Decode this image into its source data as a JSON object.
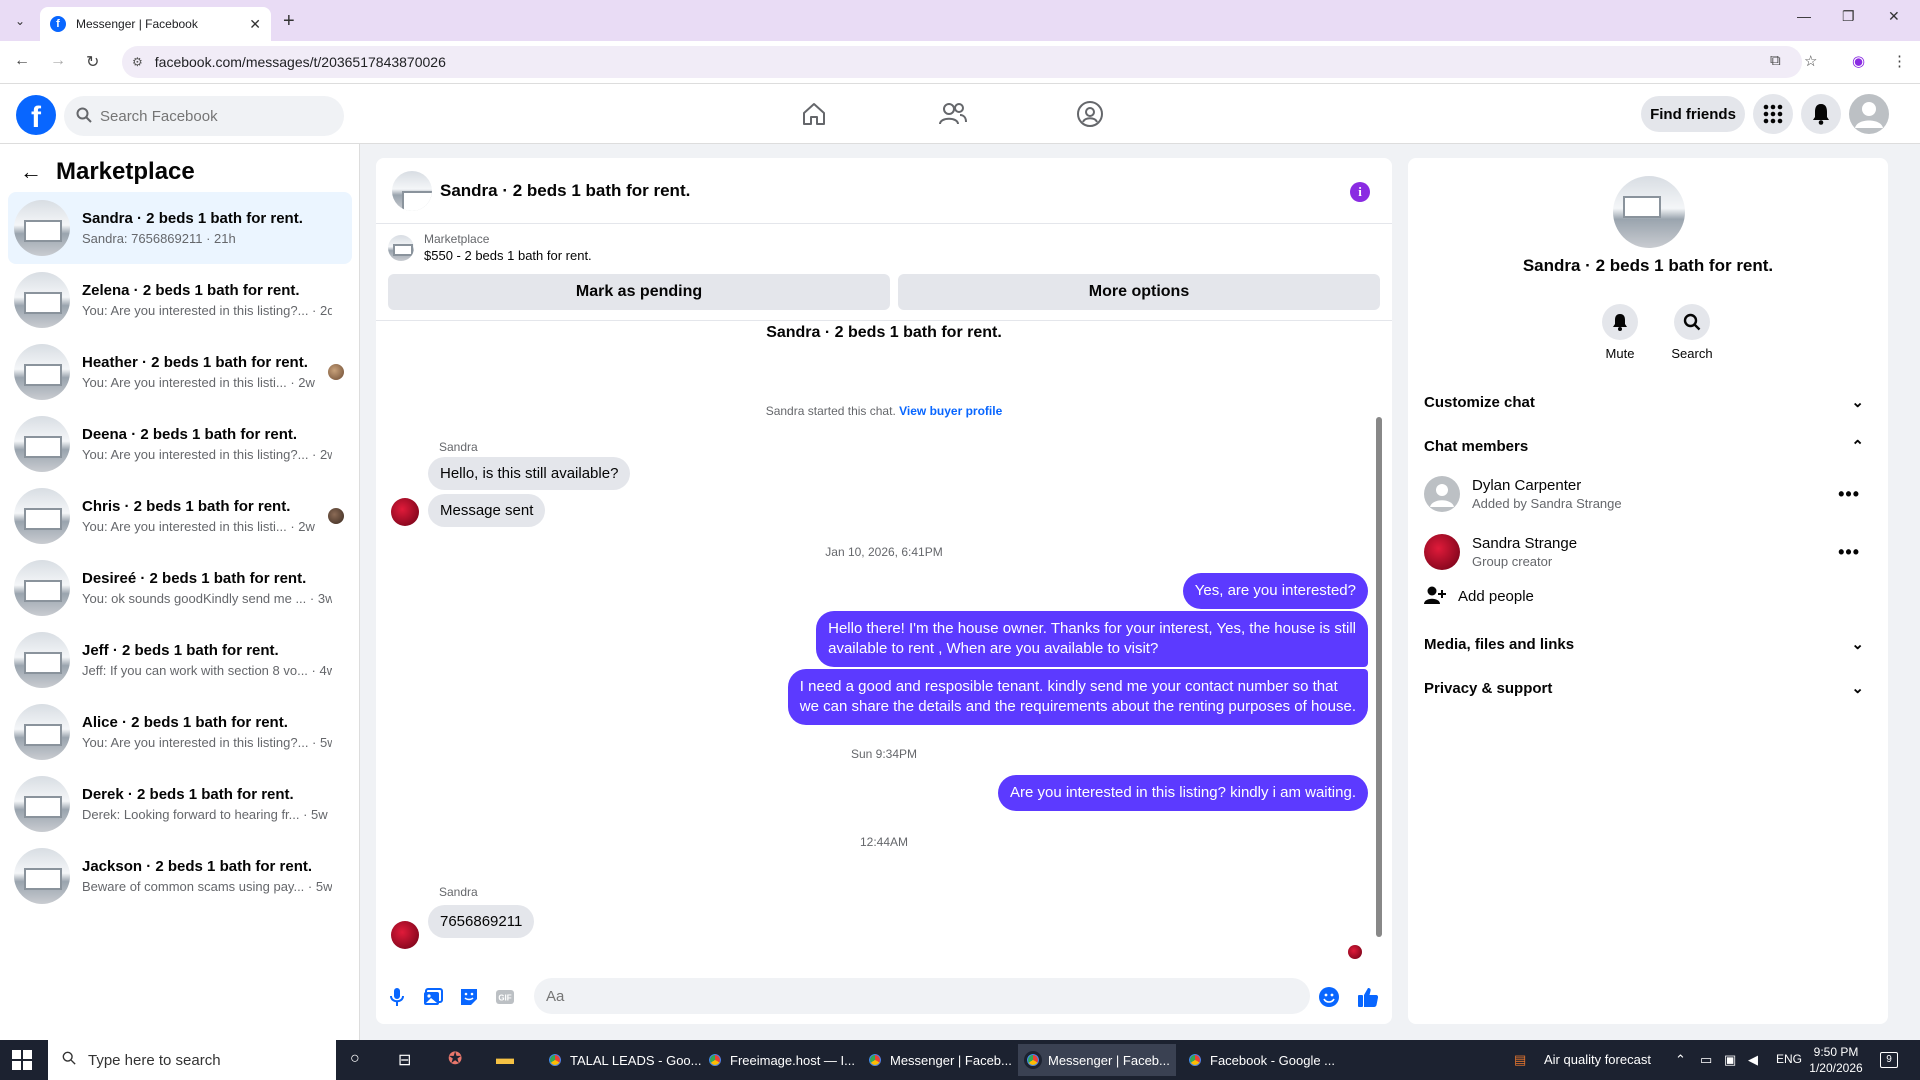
{
  "browser": {
    "tab_title": "Messenger | Facebook",
    "url": "facebook.com/messages/t/2036517843870026"
  },
  "header": {
    "search_placeholder": "Search Facebook",
    "find_friends": "Find friends"
  },
  "left": {
    "title": "Marketplace",
    "conversations": [
      {
        "name": "Sandra · 2 beds 1 bath for rent.",
        "preview": "Sandra: 7656869211 · 21h",
        "active": true
      },
      {
        "name": "Zelena · 2 beds 1 bath for rent.",
        "preview": "You: Are you interested in this listing?... · 2d"
      },
      {
        "name": "Heather · 2 beds 1 bath for rent.",
        "preview": "You: Are you interested in this listi... · 2w"
      },
      {
        "name": "Deena · 2 beds 1 bath for rent.",
        "preview": "You: Are you interested in this listing?... · 2w"
      },
      {
        "name": "Chris · 2 beds 1 bath for rent.",
        "preview": "You: Are you interested in this listi... · 2w"
      },
      {
        "name": "Desireé · 2 beds 1 bath for rent.",
        "preview": "You: ok sounds goodKindly send me ... · 3w"
      },
      {
        "name": "Jeff · 2 beds 1 bath for rent.",
        "preview": "Jeff: If you can work with section 8 vo... · 4w"
      },
      {
        "name": "Alice · 2 beds 1 bath for rent.",
        "preview": "You: Are you interested in this listing?... · 5w"
      },
      {
        "name": "Derek · 2 beds 1 bath for rent.",
        "preview": "Derek: Looking forward to hearing fr... · 5w"
      },
      {
        "name": "Jackson · 2 beds 1 bath for rent.",
        "preview": "Beware of common scams using pay... · 5w"
      }
    ]
  },
  "chat": {
    "title": "Sandra · 2 beds 1 bath for rent.",
    "marketplace_label": "Marketplace",
    "listing": "$550 - 2 beds 1 bath for rent.",
    "mark_pending": "Mark as pending",
    "more_options": "More options",
    "thread_title": "Sandra · 2 beds 1 bath for rent.",
    "started_text": "Sandra started this chat.",
    "view_buyer": "View buyer profile",
    "sender1": "Sandra",
    "msg_in_1": "Hello, is this still available?",
    "msg_in_2": "Message sent",
    "timestamp_1": "Jan 10, 2026, 6:41PM",
    "msg_out_1": "Yes, are you interested?",
    "msg_out_2_line1": "Hello there! I'm the house owner. Thanks for your interest, Yes, the house is still",
    "msg_out_2_line2": "available to rent , When are you available to visit?",
    "msg_out_3_line1": "I need a good and resposible tenant.  kindly send me your contact number so that",
    "msg_out_3_line2": "we can share the details and the requirements about the renting purposes of house.",
    "timestamp_2": "Sun 9:34PM",
    "msg_out_4": "Are you interested in this listing? kindly i am waiting.",
    "timestamp_3": "12:44AM",
    "sender2": "Sandra",
    "msg_in_3": "7656869211",
    "input_placeholder": "Aa"
  },
  "right": {
    "name": "Sandra · 2 beds 1 bath for rent.",
    "mute": "Mute",
    "search": "Search",
    "customize": "Customize chat",
    "members_label": "Chat members",
    "member1_name": "Dylan Carpenter",
    "member1_sub": "Added by Sandra Strange",
    "member2_name": "Sandra Strange",
    "member2_sub": "Group creator",
    "add_people": "Add people",
    "media": "Media, files and links",
    "privacy": "Privacy & support"
  },
  "taskbar": {
    "search": "Type here to search",
    "apps": [
      "TALAL LEADS - Goo...",
      "Freeimage.host — I...",
      "Messenger | Faceb...",
      "Messenger | Faceb...",
      "Facebook - Google ..."
    ],
    "weather": "Air quality forecast",
    "lang": "ENG",
    "time": "9:50 PM",
    "date": "1/20/2026",
    "notif_count": "9"
  },
  "colors": {
    "accent": "#5c3aff",
    "fb_blue": "#0866ff"
  }
}
